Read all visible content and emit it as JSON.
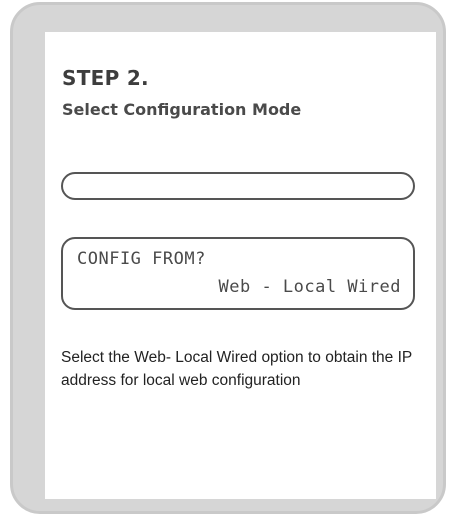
{
  "step": {
    "title": "STEP 2.",
    "subtitle": "Select Configuration Mode"
  },
  "progress": {
    "fraction": 0
  },
  "lcd": {
    "line1": "CONFIG FROM?",
    "line2": "Web - Local Wired"
  },
  "description": "Select the Web- Local Wired option to obtain the IP address for local web configuration",
  "colors": {
    "frame": "#d6d6d6",
    "border": "#555555",
    "text": "#3d3d3d"
  }
}
